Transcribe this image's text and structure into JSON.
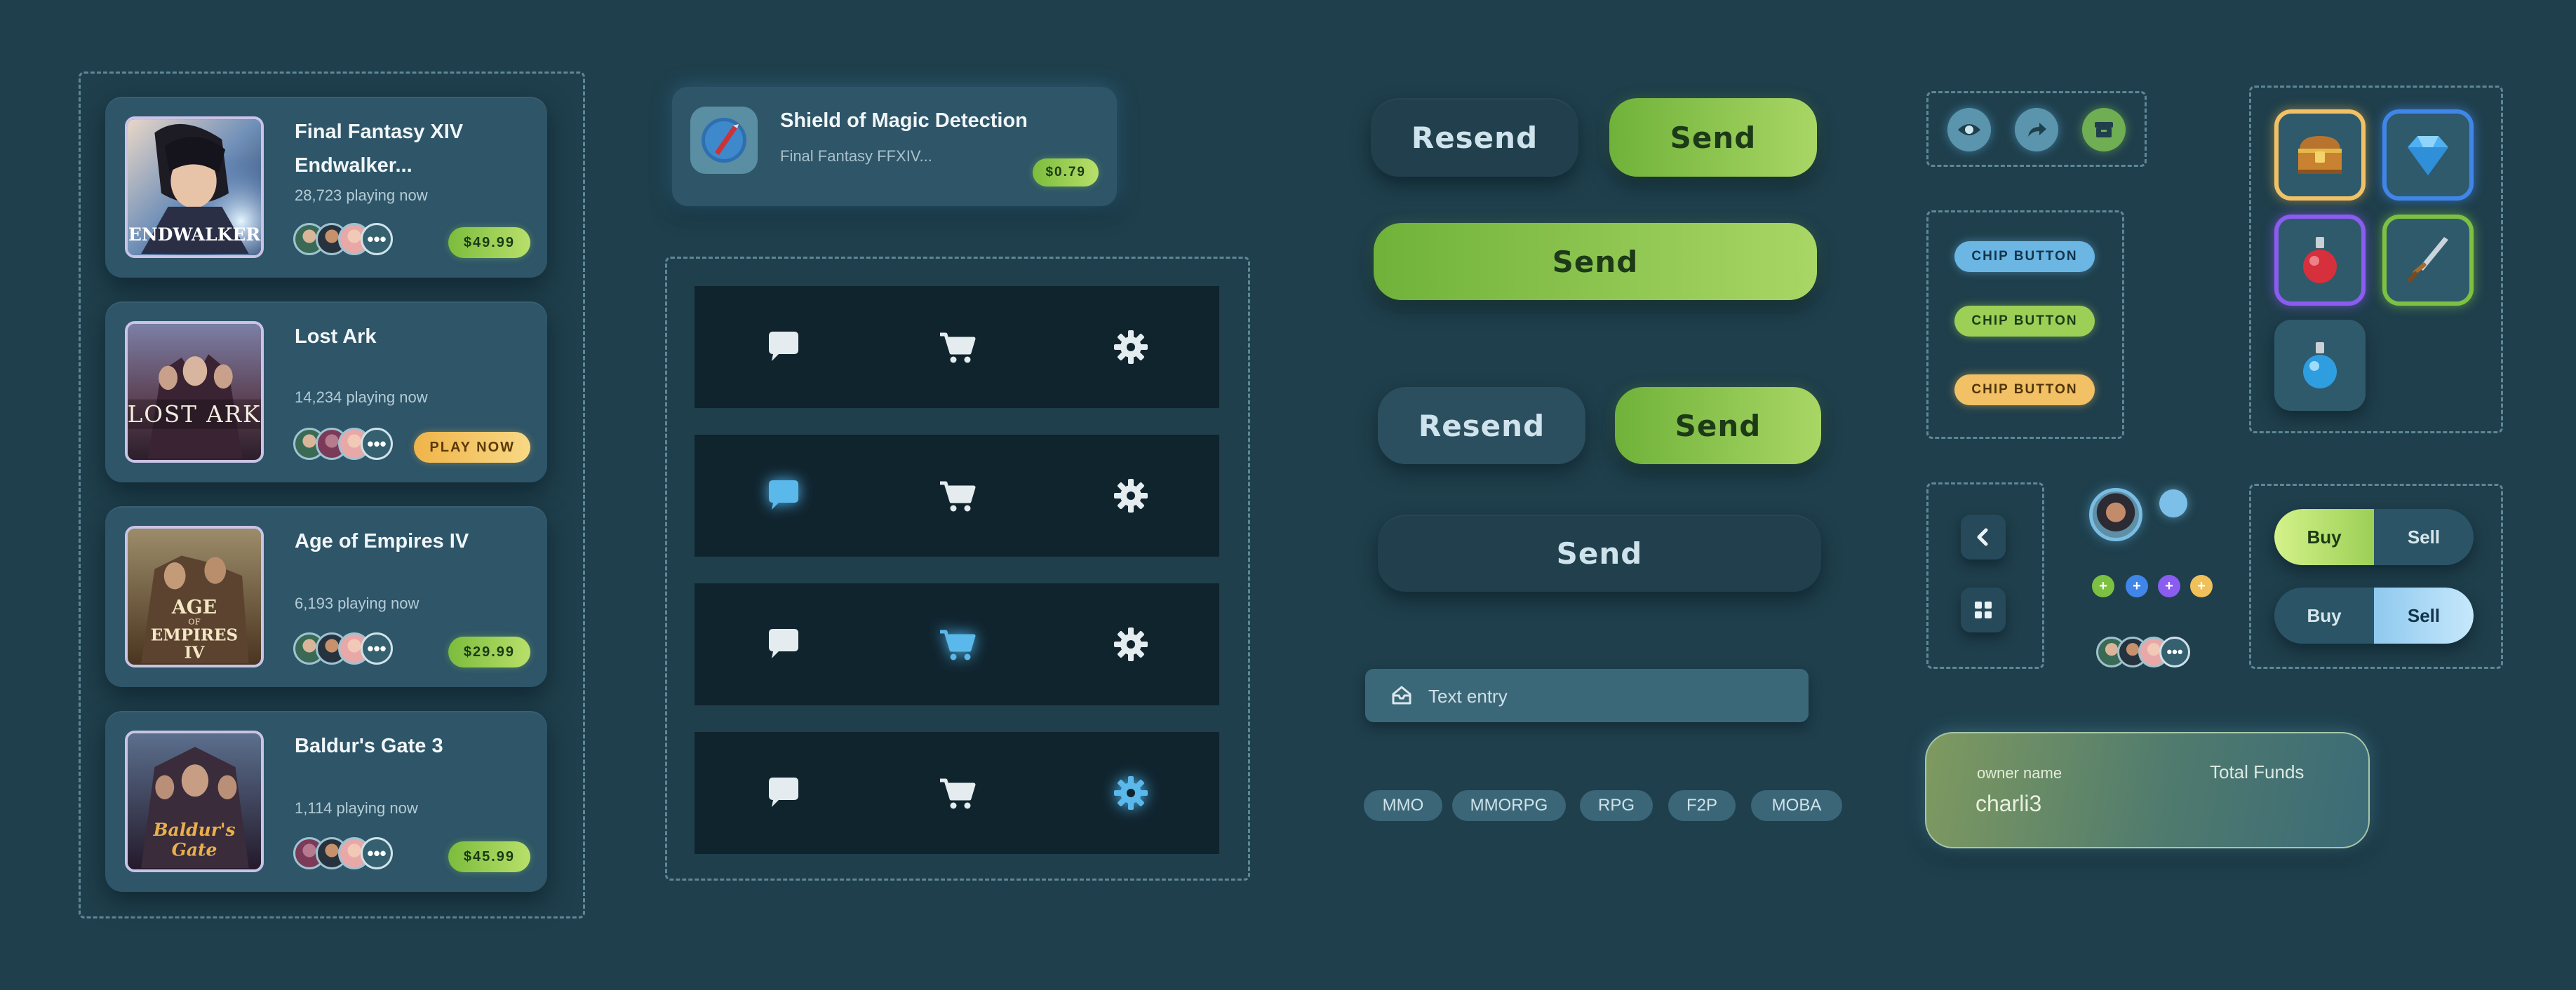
{
  "games": [
    {
      "title_line1": "Final Fantasy XIV",
      "title_line2": "Endwalker...",
      "players": "28,723 playing now",
      "action": "$49.99"
    },
    {
      "title_line1": "Lost Ark",
      "title_line2": "",
      "players": "14,234 playing now",
      "action": "PLAY NOW"
    },
    {
      "title_line1": "Age of Empires IV",
      "title_line2": "",
      "players": "6,193 playing now",
      "action": "$29.99"
    },
    {
      "title_line1": "Baldur's Gate 3",
      "title_line2": "",
      "players": "1,114 playing now",
      "action": "$45.99"
    }
  ],
  "covers": {
    "ff": "ENDWALKER",
    "lost_ark": "LOST ARK",
    "aoe_line1": "AGE",
    "aoe_line2": "EMPIRES",
    "aoe_line3": "IV",
    "aoe_small": "OF",
    "bg3_line1": "Baldur's",
    "bg3_line2": "Gate"
  },
  "item": {
    "title": "Shield of Magic Detection",
    "subtitle": "Final Fantasy FFXIV...",
    "price": "$0.79"
  },
  "buttons": {
    "resend": "Resend",
    "send": "Send"
  },
  "text_entry": {
    "placeholder": "Text entry"
  },
  "tags": [
    "MMO",
    "MMORPG",
    "RPG",
    "F2P",
    "MOBA"
  ],
  "chips": [
    "CHIP BUTTON",
    "CHIP BUTTON",
    "CHIP BUTTON"
  ],
  "segments": [
    {
      "buy": "Buy",
      "sell": "Sell",
      "active": "buy"
    },
    {
      "buy": "Buy",
      "sell": "Sell",
      "active": "sell"
    }
  ],
  "funds": {
    "owner_label": "owner name",
    "owner_value": "charli3",
    "total_label": "Total Funds"
  },
  "colors": {
    "background": "#1f3f4c",
    "card": "#2e5568",
    "green": "#9ccf56",
    "blue_glow": "#5ab8ea",
    "gold": "#f2c165",
    "purple": "#8a5cf0"
  },
  "icons": {
    "nav": [
      "chat-bubble-icon",
      "shopping-cart-icon",
      "gear-icon"
    ],
    "circles": [
      "eye-icon",
      "share-arrow-icon",
      "archive-icon"
    ],
    "slots": [
      "treasure-chest-icon",
      "diamond-icon",
      "red-potion-icon",
      "sword-icon",
      "blue-potion-icon"
    ],
    "small": [
      "chevron-left-icon",
      "grid-icon"
    ],
    "dots": [
      "plus-icon",
      "plus-icon",
      "plus-icon",
      "plus-icon"
    ]
  }
}
